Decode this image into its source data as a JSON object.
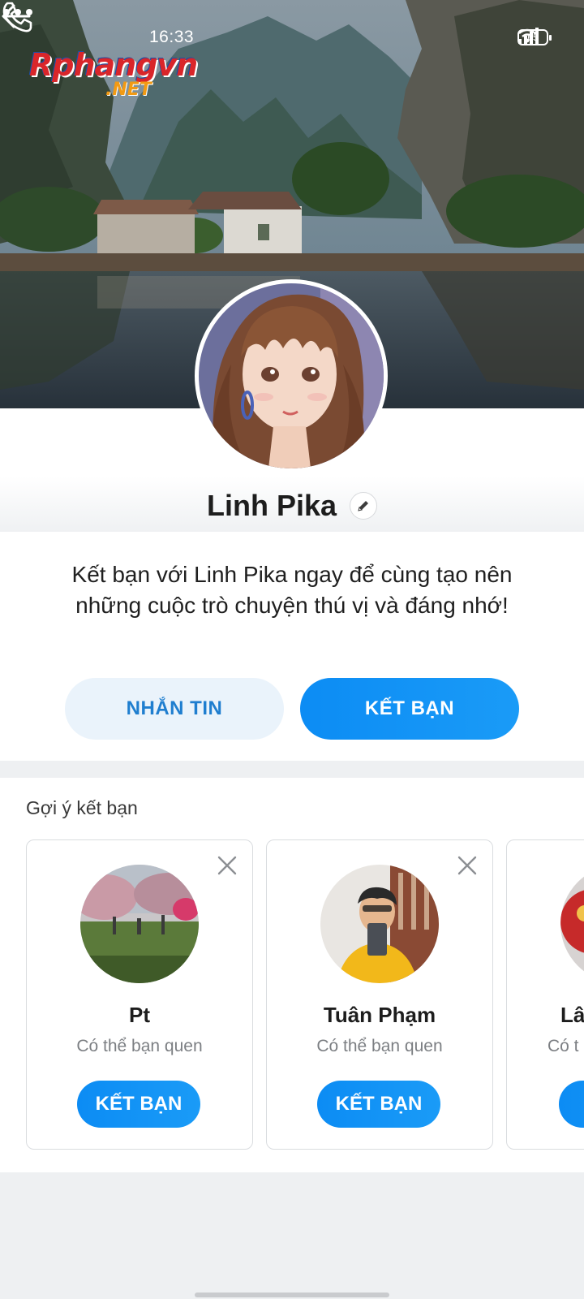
{
  "status_bar": {
    "time": "16:33",
    "battery": "65",
    "icons": [
      "wifi-icon",
      "signal-icon",
      "battery-icon"
    ]
  },
  "watermark": {
    "main": "Rphangvn",
    "sub": ".NET"
  },
  "header": {
    "back_icon": "arrow-left-icon",
    "call_icon": "phone-icon",
    "more_icon": "more-dots-icon"
  },
  "profile": {
    "name": "Linh Pika",
    "edit_icon": "pencil-icon"
  },
  "invite": {
    "message": "Kết bạn với Linh Pika ngay để cùng tạo nên những cuộc trò chuyện thú vị và đáng nhớ!",
    "message_button": "NHẮN TIN",
    "add_friend_button": "KẾT BẠN"
  },
  "suggestions": {
    "title": "Gợi ý kết bạn",
    "items": [
      {
        "name": "Pt",
        "subtitle": "Có thể bạn quen",
        "button": "KẾT BẠN"
      },
      {
        "name": "Tuân Phạm",
        "subtitle": "Có thể bạn quen",
        "button": "KẾT BẠN"
      },
      {
        "name": "Lâ",
        "subtitle": "Có t",
        "button": "K"
      }
    ]
  },
  "colors": {
    "accent": "#0c8cf4",
    "secondary_button_bg": "#eaf3fb",
    "secondary_button_text": "#1f7ecf"
  }
}
